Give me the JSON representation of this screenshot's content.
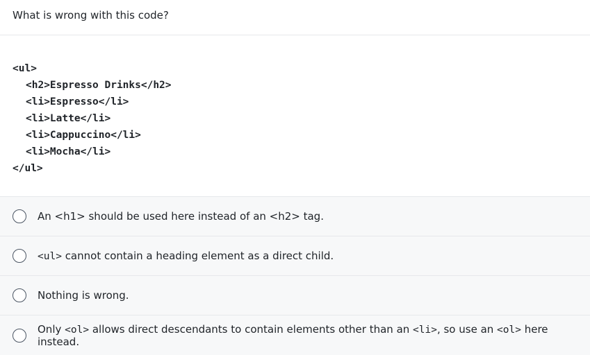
{
  "question": "What is wrong with this code?",
  "code": {
    "lines": [
      {
        "text": "<ul>",
        "indent": false
      },
      {
        "text": "<h2>Espresso Drinks</h2>",
        "indent": true
      },
      {
        "text": "<li>Espresso</li>",
        "indent": true
      },
      {
        "text": "<li>Latte</li>",
        "indent": true
      },
      {
        "text": "<li>Cappuccino</li>",
        "indent": true
      },
      {
        "text": "<li>Mocha</li>",
        "indent": true
      },
      {
        "text": "</ul>",
        "indent": false
      }
    ]
  },
  "options": [
    {
      "segments": [
        {
          "text": "An <h1> should be used here instead of an <h2> tag.",
          "mono": false
        }
      ]
    },
    {
      "segments": [
        {
          "text": "<ul>",
          "mono": true
        },
        {
          "text": " cannot contain a heading element as a direct child.",
          "mono": false
        }
      ]
    },
    {
      "segments": [
        {
          "text": "Nothing is wrong.",
          "mono": false
        }
      ]
    },
    {
      "segments": [
        {
          "text": "Only ",
          "mono": false
        },
        {
          "text": "<ol>",
          "mono": true
        },
        {
          "text": " allows direct descendants to contain elements other than an ",
          "mono": false
        },
        {
          "text": "<li>",
          "mono": true
        },
        {
          "text": ", so use an ",
          "mono": false
        },
        {
          "text": "<ol>",
          "mono": true
        },
        {
          "text": " here instead.",
          "mono": false
        }
      ]
    }
  ]
}
